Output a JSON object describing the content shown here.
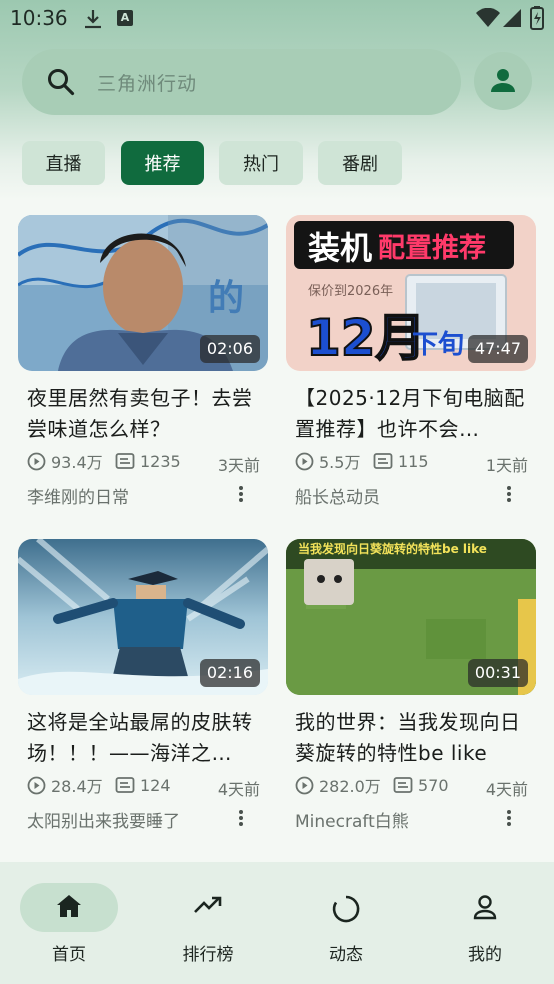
{
  "status_bar": {
    "time": "10:36",
    "notice_icon_letter": "A"
  },
  "search": {
    "placeholder": "三角洲行动"
  },
  "tabs": [
    {
      "label": "直播",
      "active": false
    },
    {
      "label": "推荐",
      "active": true
    },
    {
      "label": "热门",
      "active": false
    },
    {
      "label": "番剧",
      "active": false
    }
  ],
  "videos": [
    {
      "title": "夜里居然有卖包子！去尝尝味道怎么样？",
      "duration": "02:06",
      "views": "93.4万",
      "danmaku": "1235",
      "date": "3天前",
      "author": "李维刚的日常"
    },
    {
      "title": "【2025·12月下旬电脑配置推荐】也许不会…",
      "duration": "47:47",
      "views": "5.5万",
      "danmaku": "115",
      "date": "1天前",
      "author": "船长总动员",
      "thumb_text": {
        "line1a": "装机",
        "line1b": "配置推荐",
        "sub": "保价到2026年",
        "big": "12月",
        "small": "下旬"
      }
    },
    {
      "title": "这将是全站最屌的皮肤转场！！！——海洋之…",
      "duration": "02:16",
      "views": "28.4万",
      "danmaku": "124",
      "date": "4天前",
      "author": "太阳别出来我要睡了"
    },
    {
      "title": "我的世界：当我发现向日葵旋转的特性be like",
      "duration": "00:31",
      "views": "282.0万",
      "danmaku": "570",
      "date": "4天前",
      "author": "Minecraft白熊",
      "thumb_text": {
        "caption": "当我发现向日葵旋转的特性be like"
      }
    }
  ],
  "bottom_nav": [
    {
      "label": "首页",
      "icon": "home-icon",
      "active": true
    },
    {
      "label": "排行榜",
      "icon": "trending-icon",
      "active": false
    },
    {
      "label": "动态",
      "icon": "refresh-ring-icon",
      "active": false
    },
    {
      "label": "我的",
      "icon": "person-icon",
      "active": false
    }
  ],
  "colors": {
    "accent": "#106b3e",
    "chip": "#cfe4d6",
    "nav_bg": "#e4efe7"
  }
}
